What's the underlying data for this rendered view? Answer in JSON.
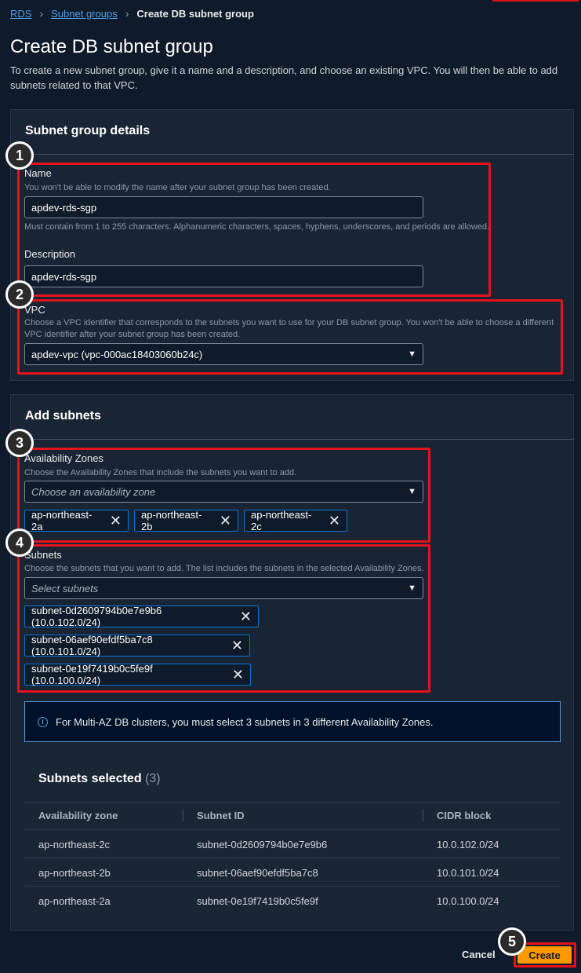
{
  "breadcrumb": {
    "rds": "RDS",
    "subnet_groups": "Subnet groups",
    "current": "Create DB subnet group"
  },
  "page": {
    "title": "Create DB subnet group",
    "intro": "To create a new subnet group, give it a name and a description, and choose an existing VPC. You will then be able to add subnets related to that VPC."
  },
  "details": {
    "title": "Subnet group details",
    "name_label": "Name",
    "name_hint": "You won't be able to modify the name after your subnet group has been created.",
    "name_value": "apdev-rds-sgp",
    "name_constraint": "Must contain from 1 to 255 characters. Alphanumeric characters, spaces, hyphens, underscores, and periods are allowed.",
    "description_label": "Description",
    "description_value": "apdev-rds-sgp",
    "vpc_label": "VPC",
    "vpc_hint": "Choose a VPC identifier that corresponds to the subnets you want to use for your DB subnet group. You won't be able to choose a different VPC identifier after your subnet group has been created.",
    "vpc_value": "apdev-vpc (vpc-000ac18403060b24c)"
  },
  "add_subnets": {
    "title": "Add subnets",
    "az_label": "Availability Zones",
    "az_hint": "Choose the Availability Zones that include the subnets you want to add.",
    "az_placeholder": "Choose an availability zone",
    "az_tokens": [
      "ap-northeast-2a",
      "ap-northeast-2b",
      "ap-northeast-2c"
    ],
    "subnets_label": "Subnets",
    "subnets_hint": "Choose the subnets that you want to add. The list includes the subnets in the selected Availability Zones.",
    "subnets_placeholder": "Select subnets",
    "subnet_tokens": [
      "subnet-0d2609794b0e7e9b6 (10.0.102.0/24)",
      "subnet-06aef90efdf5ba7c8 (10.0.101.0/24)",
      "subnet-0e19f7419b0c5fe9f (10.0.100.0/24)"
    ],
    "info_text": "For Multi-AZ DB clusters, you must select 3 subnets in 3 different Availability Zones."
  },
  "selected": {
    "title": "Subnets selected",
    "count": "(3)",
    "columns": [
      "Availability zone",
      "Subnet ID",
      "CIDR block"
    ],
    "rows": [
      [
        "ap-northeast-2c",
        "subnet-0d2609794b0e7e9b6",
        "10.0.102.0/24"
      ],
      [
        "ap-northeast-2b",
        "subnet-06aef90efdf5ba7c8",
        "10.0.101.0/24"
      ],
      [
        "ap-northeast-2a",
        "subnet-0e19f7419b0c5fe9f",
        "10.0.100.0/24"
      ]
    ]
  },
  "footer": {
    "cancel": "Cancel",
    "create": "Create"
  },
  "annotations": {
    "b1": "1",
    "b2": "2",
    "b3": "3",
    "b4": "4",
    "b5": "5"
  },
  "colors": {
    "accent": "#ff9900",
    "link": "#539fe5",
    "highlight": "#e4131b",
    "token_border": "#0972d3"
  },
  "icons": {
    "dropdown": "caret-down-icon",
    "remove": "close-icon",
    "info": "info-icon",
    "breadcrumb_sep": "chevron-right-icon"
  }
}
